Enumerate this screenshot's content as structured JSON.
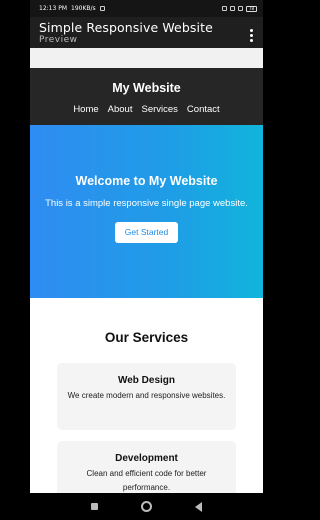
{
  "status_bar": {
    "time": "12:13 PM",
    "speed": "190KB/s",
    "battery": "78"
  },
  "app_bar": {
    "title": "Simple Responsive Website",
    "subtitle": "Preview"
  },
  "site": {
    "name": "My Website",
    "nav": [
      "Home",
      "About",
      "Services",
      "Contact"
    ]
  },
  "hero": {
    "title": "Welcome to My Website",
    "text": "This is a simple responsive single page website.",
    "button": "Get Started"
  },
  "services": {
    "title": "Our Services",
    "cards": [
      {
        "title": "Web Design",
        "text": "We create modern and responsive websites."
      },
      {
        "title": "Development",
        "text": "Clean and efficient code for better performance."
      }
    ]
  },
  "colors": {
    "hero_start": "#2f8cf2",
    "hero_end": "#10b5dc",
    "header_bg": "#262626",
    "button_text": "#1f8ee8"
  }
}
